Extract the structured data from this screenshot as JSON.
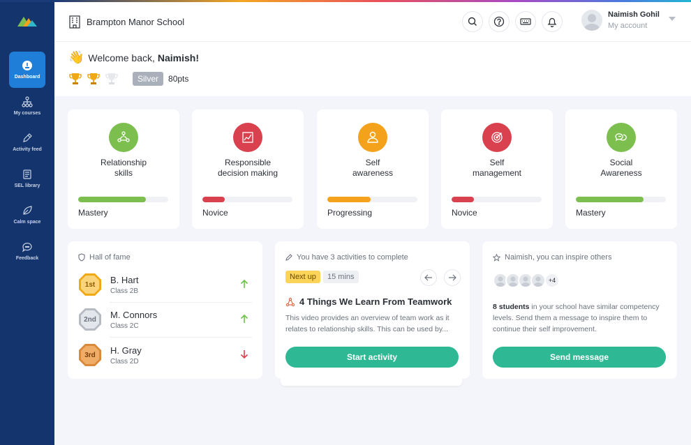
{
  "header": {
    "school": "Brampton Manor School",
    "user_name": "Naimish Gohil",
    "user_sub": "My account"
  },
  "sidebar": {
    "items": [
      {
        "label": "Dashboard",
        "icon": "dashboard-icon",
        "active": true
      },
      {
        "label": "My courses",
        "icon": "courses-icon"
      },
      {
        "label": "Activity feed",
        "icon": "pencil-icon"
      },
      {
        "label": "SEL library",
        "icon": "library-icon"
      },
      {
        "label": "Calm space",
        "icon": "leaf-icon"
      },
      {
        "label": "Feedback",
        "icon": "chat-icon"
      }
    ]
  },
  "welcome": {
    "greeting": "Welcome back,",
    "name": "Naimish!",
    "tier": "Silver",
    "points": "80pts"
  },
  "competencies": [
    {
      "name": "Relationship\nskills",
      "level": "Mastery",
      "progress": 0.75,
      "color": "#7dbf4f",
      "icon": "people-icon"
    },
    {
      "name": "Responsible\ndecision making",
      "level": "Novice",
      "progress": 0.25,
      "color": "#d9414e",
      "icon": "chart-icon"
    },
    {
      "name": "Self\nawareness",
      "level": "Progressing",
      "progress": 0.48,
      "color": "#f4a21b",
      "icon": "person-icon"
    },
    {
      "name": "Self\nmanagement",
      "level": "Novice",
      "progress": 0.25,
      "color": "#d9414e",
      "icon": "target-icon"
    },
    {
      "name": "Social\nAwareness",
      "level": "Mastery",
      "progress": 0.75,
      "color": "#7dbf4f",
      "icon": "speech-icon"
    }
  ],
  "hall_of_fame": {
    "title": "Hall of fame",
    "rows": [
      {
        "rank": "1st",
        "name": "B. Hart",
        "class": "Class 2B",
        "trend": "up"
      },
      {
        "rank": "2nd",
        "name": "M. Connors",
        "class": "Class 2C",
        "trend": "up"
      },
      {
        "rank": "3rd",
        "name": "H. Gray",
        "class": "Class 2D",
        "trend": "down"
      }
    ]
  },
  "activities": {
    "title": "You have 3 activities to complete",
    "next_up": "Next up",
    "duration": "15 mins",
    "activity_title": "4 Things We Learn From Teamwork",
    "description": "This video provides an overview of team work as it relates to relationship skills. This can be used by...",
    "button": "Start activity"
  },
  "inspire": {
    "title": "Naimish, you can inspire others",
    "more": "+4",
    "count_text": "8 students",
    "text": " in your school have similar competency levels. Send them a message to inspire them to continue their self improvement.",
    "button": "Send message"
  }
}
